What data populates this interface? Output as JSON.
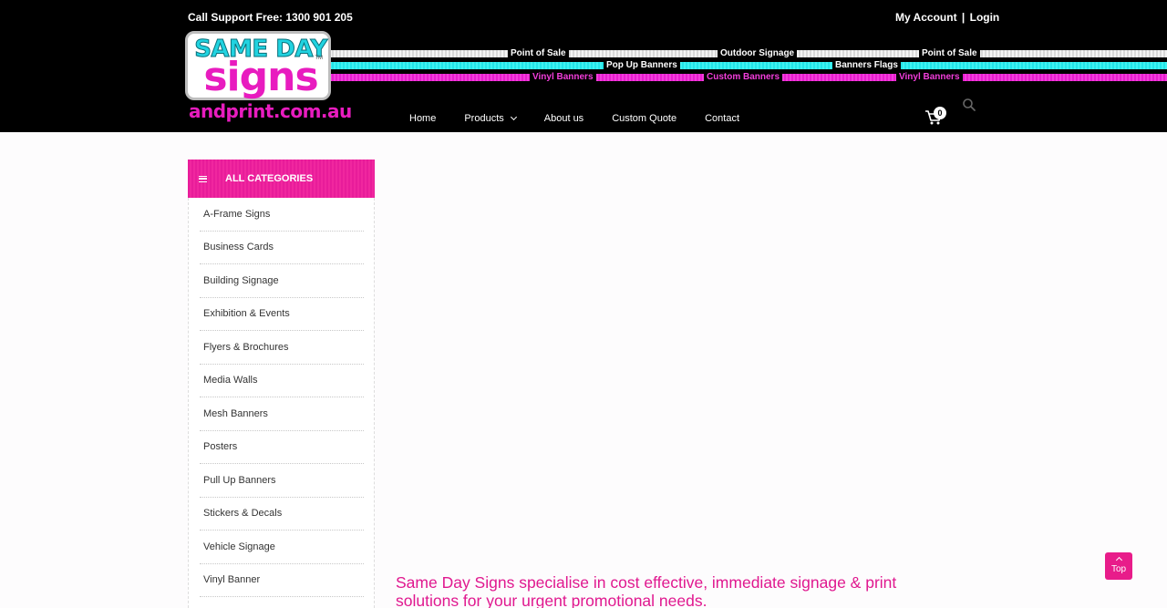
{
  "header": {
    "support_text": "Call Support Free: 1300 901 205",
    "account_label": "My Account",
    "account_separator": "|",
    "login_label": "Login",
    "logo": {
      "line1": "SAME DAY",
      "line2": "signs",
      "tm": "TM",
      "domain": "andprint.com.au"
    },
    "stripe_labels": {
      "row1": [
        "Point of Sale",
        "Outdoor Signage",
        "Point of Sale"
      ],
      "row2": [
        "Pop Up Banners",
        "Banners Flags"
      ],
      "row3": [
        "Vinyl Banners",
        "Custom Banners",
        "Vinyl Banners"
      ]
    },
    "nav": {
      "home": "Home",
      "products": "Products",
      "about": "About us",
      "quote": "Custom Quote",
      "contact": "Contact"
    },
    "cart_count": "0"
  },
  "sidebar": {
    "title": "ALL CATEGORIES",
    "items": [
      "A-Frame Signs",
      "Business Cards",
      "Building Signage",
      "Exhibition & Events",
      "Flyers & Brochures",
      "Media Walls",
      "Mesh Banners",
      "Posters",
      "Pull Up Banners",
      "Stickers & Decals",
      "Vehicle Signage",
      "Vinyl Banner"
    ]
  },
  "main": {
    "tagline": "Same Day Signs specialise in cost effective, immediate signage & print solutions for your urgent promotional needs."
  },
  "top_button": {
    "label": "Top"
  },
  "colors": {
    "accent_pink": "#e81c8a",
    "cyan": "#22e6e8",
    "magenta": "#e81ccf",
    "header_bg": "#000000"
  },
  "icons": {
    "menu": "hamburger-icon",
    "cart": "cart-icon",
    "search": "search-icon",
    "products_dropdown": "chevron-down-icon",
    "top": "chevron-up-icon"
  }
}
